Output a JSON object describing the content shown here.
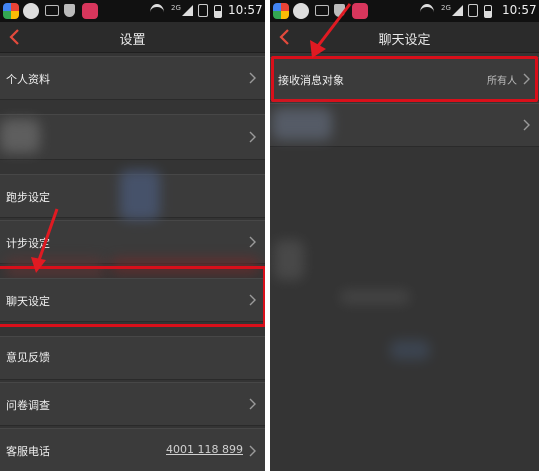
{
  "left": {
    "status": {
      "time": "10:57",
      "network": "2G"
    },
    "title": "设置",
    "items": [
      {
        "label": "个人资料"
      },
      {
        "label": ""
      },
      {
        "label": "跑步设定"
      },
      {
        "label": "计步设定"
      },
      {
        "label": "聊天设定"
      },
      {
        "label": "意见反馈"
      },
      {
        "label": "问卷调查"
      },
      {
        "label": "客服电话",
        "value": "4001 118 899"
      }
    ]
  },
  "right": {
    "status": {
      "time": "10:57",
      "network": "2G"
    },
    "title": "聊天设定",
    "items": [
      {
        "label": "接收消息对象",
        "value": "所有人"
      },
      {
        "label": ""
      }
    ]
  },
  "colors": {
    "accent": "#d90f1a",
    "background": "#343434"
  }
}
